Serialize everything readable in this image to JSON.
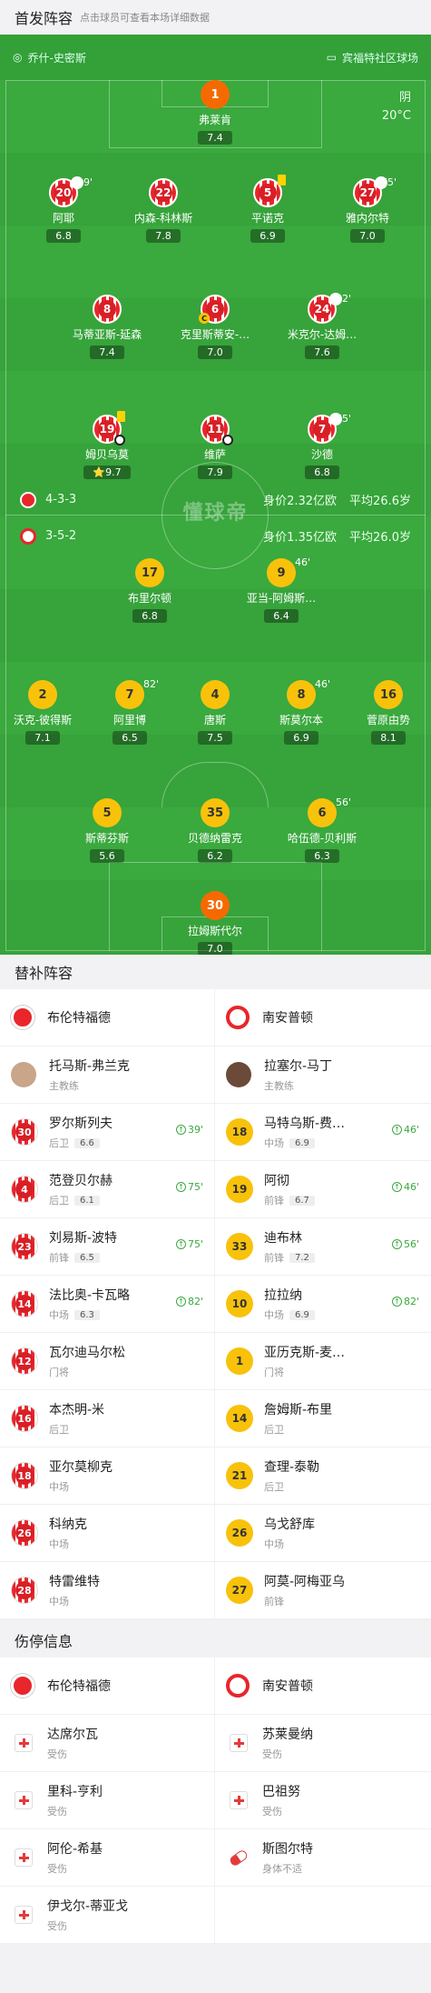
{
  "header": {
    "title": "首发阵容",
    "hint": "点击球员可查看本场详细数据"
  },
  "match": {
    "home_coach_short": "乔什-史密斯",
    "venue": "宾福特社区球场",
    "weather": "阴",
    "temperature": "20°C",
    "watermark": "懂球帝"
  },
  "home_team": {
    "name": "布伦特福德",
    "formation": "4-3-3",
    "value": "身价2.32亿欧",
    "age": "平均26.6岁",
    "color": "#e8262b",
    "coach": {
      "name": "托马斯-弗兰克",
      "role": "主教练"
    }
  },
  "away_team": {
    "name": "南安普顿",
    "formation": "3-5-2",
    "value": "身价1.35亿欧",
    "age": "平均26.0岁",
    "color": "#f8c20b",
    "coach": {
      "name": "拉塞尔-马丁",
      "role": "主教练"
    }
  },
  "pitch_players": [
    {
      "num": "1",
      "name": "弗莱肯",
      "rating": "7.4",
      "kit": "orange"
    },
    {
      "num": "20",
      "name": "阿耶",
      "rating": "6.8",
      "kit": "red",
      "sub": "39'"
    },
    {
      "num": "22",
      "name": "内森-科林斯",
      "rating": "7.8",
      "kit": "red"
    },
    {
      "num": "5",
      "name": "平诺克",
      "rating": "6.9",
      "kit": "red",
      "card": "yellow"
    },
    {
      "num": "27",
      "name": "雅内尔特",
      "rating": "7.0",
      "kit": "red",
      "sub": "75'"
    },
    {
      "num": "8",
      "name": "马蒂亚斯-延森",
      "rating": "7.4",
      "kit": "red"
    },
    {
      "num": "6",
      "name": "克里斯蒂安-…",
      "rating": "7.0",
      "kit": "red",
      "captain": "C"
    },
    {
      "num": "24",
      "name": "米克尔-达姆…",
      "rating": "7.6",
      "kit": "red",
      "sub": "82'"
    },
    {
      "num": "19",
      "name": "姆贝乌莫",
      "rating": "9.7",
      "kit": "red",
      "card": "yellow",
      "goal": true,
      "star": "⭐"
    },
    {
      "num": "11",
      "name": "维萨",
      "rating": "7.9",
      "kit": "red",
      "goal": true
    },
    {
      "num": "7",
      "name": "沙德",
      "rating": "6.8",
      "kit": "red",
      "sub": "75'"
    },
    {
      "num": "17",
      "name": "布里尔顿",
      "rating": "6.8",
      "kit": "yellow"
    },
    {
      "num": "9",
      "name": "亚当-阿姆斯…",
      "rating": "6.4",
      "kit": "yellow",
      "sub": "46'"
    },
    {
      "num": "2",
      "name": "沃克-彼得斯",
      "rating": "7.1",
      "kit": "yellow"
    },
    {
      "num": "7",
      "name": "阿里博",
      "rating": "6.5",
      "kit": "yellow",
      "sub": "82'"
    },
    {
      "num": "4",
      "name": "唐斯",
      "rating": "7.5",
      "kit": "yellow"
    },
    {
      "num": "8",
      "name": "斯莫尔本",
      "rating": "6.9",
      "kit": "yellow",
      "sub": "46'"
    },
    {
      "num": "16",
      "name": "菅原由势",
      "rating": "8.1",
      "kit": "yellow",
      "goal": true
    },
    {
      "num": "5",
      "name": "斯蒂芬斯",
      "rating": "5.6",
      "kit": "yellow",
      "captain": "C"
    },
    {
      "num": "35",
      "name": "贝德纳雷克",
      "rating": "6.2",
      "kit": "yellow"
    },
    {
      "num": "6",
      "name": "哈伍德-贝利斯",
      "rating": "6.3",
      "kit": "yellow",
      "card": "yellow",
      "sub": "56'"
    },
    {
      "num": "30",
      "name": "拉姆斯代尔",
      "rating": "7.0",
      "kit": "orange"
    }
  ],
  "subs_header": "替补阵容",
  "subs_rows": [
    [
      {
        "num": "30",
        "name": "罗尔斯列夫",
        "pos": "后卫",
        "rating": "6.6",
        "in": "39'"
      },
      {
        "num": "18",
        "name": "马特乌斯-费…",
        "pos": "中场",
        "rating": "6.9",
        "in": "46'"
      }
    ],
    [
      {
        "num": "4",
        "name": "范登贝尔赫",
        "pos": "后卫",
        "rating": "6.1",
        "in": "75'"
      },
      {
        "num": "19",
        "name": "阿彻",
        "pos": "前锋",
        "rating": "6.7",
        "in": "46'"
      }
    ],
    [
      {
        "num": "23",
        "name": "刘易斯-波特",
        "pos": "前锋",
        "rating": "6.5",
        "in": "75'"
      },
      {
        "num": "33",
        "name": "迪布林",
        "pos": "前锋",
        "rating": "7.2",
        "in": "56'"
      }
    ],
    [
      {
        "num": "14",
        "name": "法比奥-卡瓦略",
        "pos": "中场",
        "rating": "6.3",
        "in": "82'"
      },
      {
        "num": "10",
        "name": "拉拉纳",
        "pos": "中场",
        "rating": "6.9",
        "in": "82'"
      }
    ],
    [
      {
        "num": "12",
        "name": "瓦尔迪马尔松",
        "pos": "门将"
      },
      {
        "num": "1",
        "name": "亚历克斯-麦…",
        "pos": "门将"
      }
    ],
    [
      {
        "num": "16",
        "name": "本杰明-米",
        "pos": "后卫"
      },
      {
        "num": "14",
        "name": "詹姆斯-布里",
        "pos": "后卫"
      }
    ],
    [
      {
        "num": "18",
        "name": "亚尔莫柳克",
        "pos": "中场"
      },
      {
        "num": "21",
        "name": "查理-泰勒",
        "pos": "后卫"
      }
    ],
    [
      {
        "num": "26",
        "name": "科纳克",
        "pos": "中场"
      },
      {
        "num": "26",
        "name": "乌戈舒库",
        "pos": "中场"
      }
    ],
    [
      {
        "num": "28",
        "name": "特雷维特",
        "pos": "中场"
      },
      {
        "num": "27",
        "name": "阿莫-阿梅亚乌",
        "pos": "前锋"
      }
    ]
  ],
  "injury_header": "伤停信息",
  "injury_rows": [
    [
      {
        "name": "达席尔瓦",
        "status": "受伤",
        "icon": "injury"
      },
      {
        "name": "苏莱曼纳",
        "status": "受伤",
        "icon": "injury"
      }
    ],
    [
      {
        "name": "里科-亨利",
        "status": "受伤",
        "icon": "injury"
      },
      {
        "name": "巴祖努",
        "status": "受伤",
        "icon": "injury"
      }
    ],
    [
      {
        "name": "阿伦-希基",
        "status": "受伤",
        "icon": "injury"
      },
      {
        "name": "斯图尔特",
        "status": "身体不适",
        "icon": "pill"
      }
    ],
    [
      {
        "name": "伊戈尔-蒂亚戈",
        "status": "受伤",
        "icon": "injury"
      },
      null
    ]
  ]
}
